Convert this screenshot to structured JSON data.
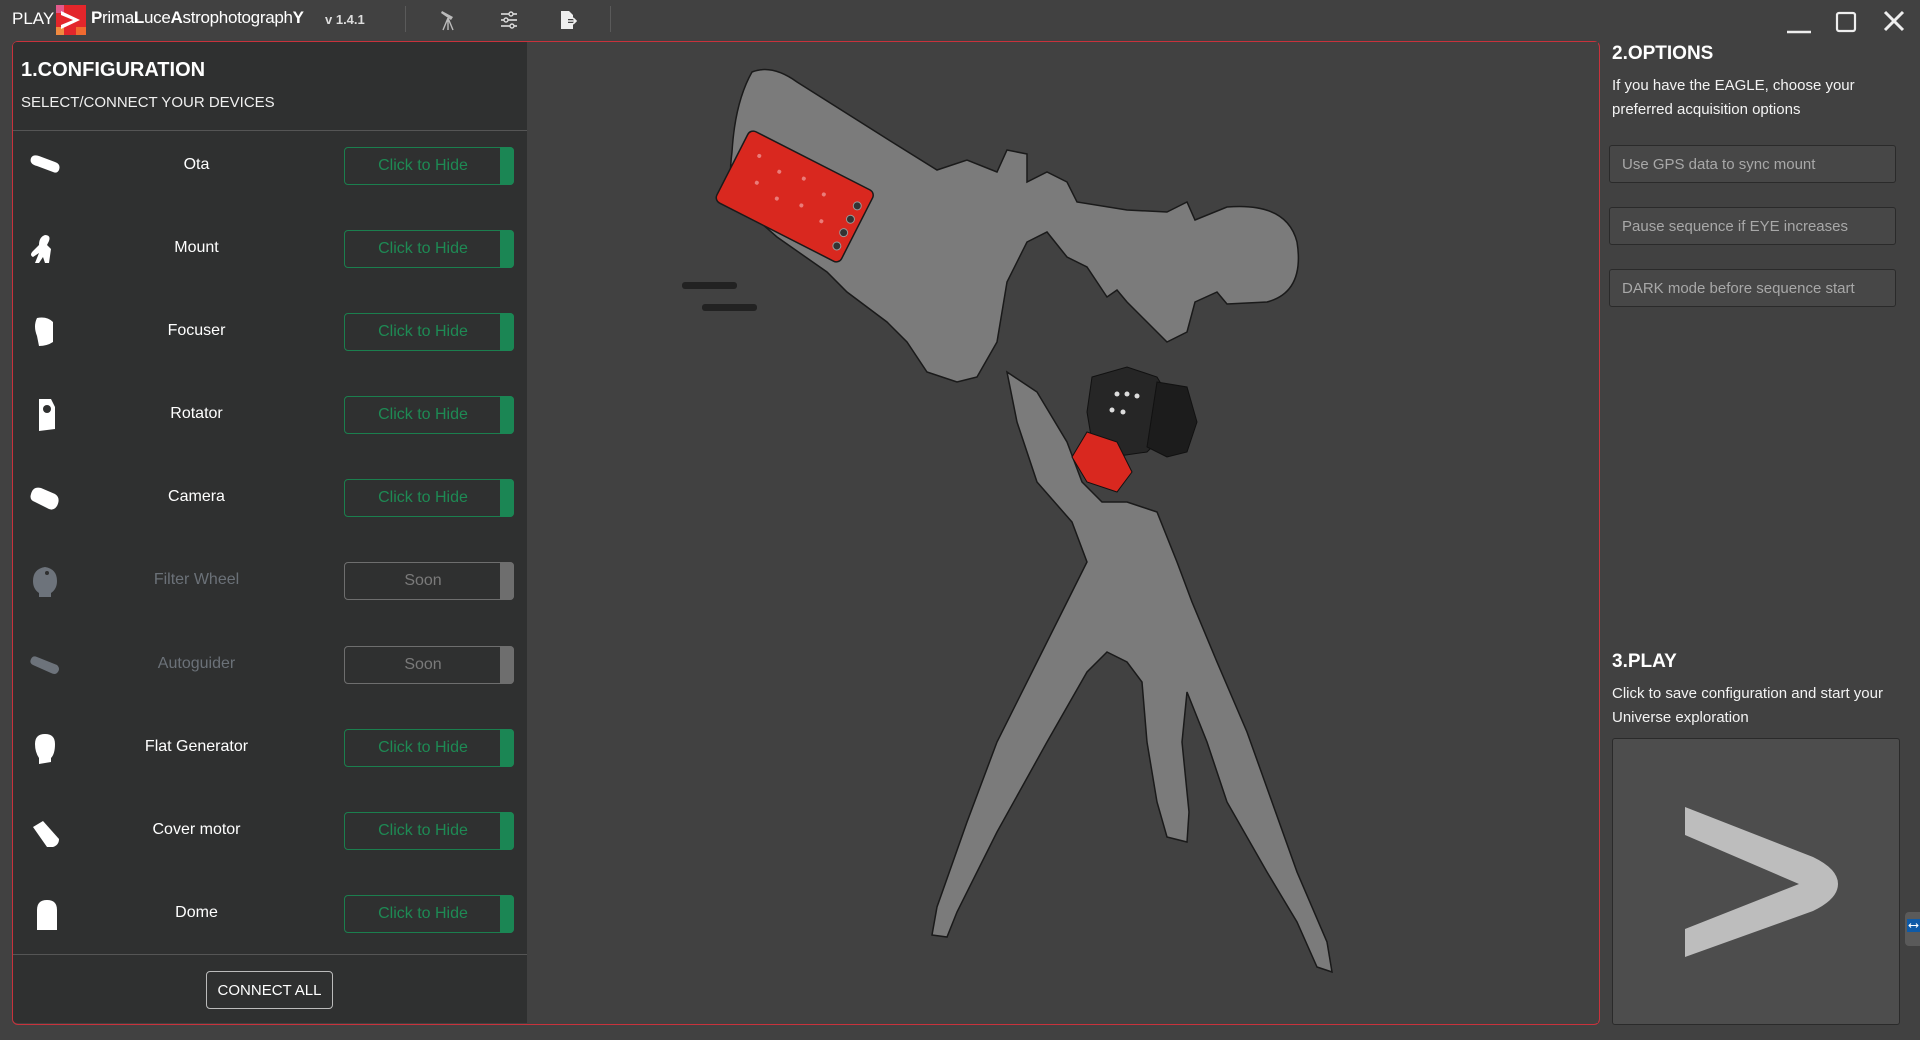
{
  "titlebar": {
    "app_mode": "PLAY",
    "brand": {
      "p1b": "P",
      "p1": "rima",
      "p2b": "L",
      "p2": "uce",
      "p3b": "A",
      "p3": "strophotograph",
      "p4b": "Y"
    },
    "version": "v 1.4.1",
    "icons": [
      "telescope-icon",
      "settings-sliders-icon",
      "export-icon"
    ],
    "window_controls": [
      "minimize",
      "maximize",
      "close"
    ]
  },
  "configuration": {
    "title": "1.CONFIGURATION",
    "subtitle": "SELECT/CONNECT YOUR DEVICES",
    "devices": [
      {
        "name": "Ota",
        "icon": "ota-icon",
        "button": "Click to Hide",
        "enabled": true
      },
      {
        "name": "Mount",
        "icon": "mount-icon",
        "button": "Click to Hide",
        "enabled": true
      },
      {
        "name": "Focuser",
        "icon": "focuser-icon",
        "button": "Click to Hide",
        "enabled": true
      },
      {
        "name": "Rotator",
        "icon": "rotator-icon",
        "button": "Click to Hide",
        "enabled": true
      },
      {
        "name": "Camera",
        "icon": "camera-icon",
        "button": "Click to Hide",
        "enabled": true
      },
      {
        "name": "Filter Wheel",
        "icon": "filter-wheel-icon",
        "button": "Soon",
        "enabled": false
      },
      {
        "name": "Autoguider",
        "icon": "autoguider-icon",
        "button": "Soon",
        "enabled": false
      },
      {
        "name": "Flat Generator",
        "icon": "flat-generator-icon",
        "button": "Click to Hide",
        "enabled": true
      },
      {
        "name": "Cover motor",
        "icon": "cover-motor-icon",
        "button": "Click to Hide",
        "enabled": true
      },
      {
        "name": "Dome",
        "icon": "dome-icon",
        "button": "Click to Hide",
        "enabled": true
      }
    ],
    "connect_all": "CONNECT ALL"
  },
  "options": {
    "title": "2.OPTIONS",
    "description": "If you have the EAGLE, choose your preferred acquisition options",
    "buttons": [
      "Use GPS data to sync mount",
      "Pause sequence if EYE increases",
      "DARK mode before sequence start"
    ]
  },
  "play": {
    "title": "3.PLAY",
    "description": "Click to save configuration and start your Universe exploration",
    "button_icon": "play-chevron-icon"
  },
  "colors": {
    "accent_red": "#c8323c",
    "active_green": "#1b8654",
    "disabled_gray": "#6e6e6e"
  }
}
